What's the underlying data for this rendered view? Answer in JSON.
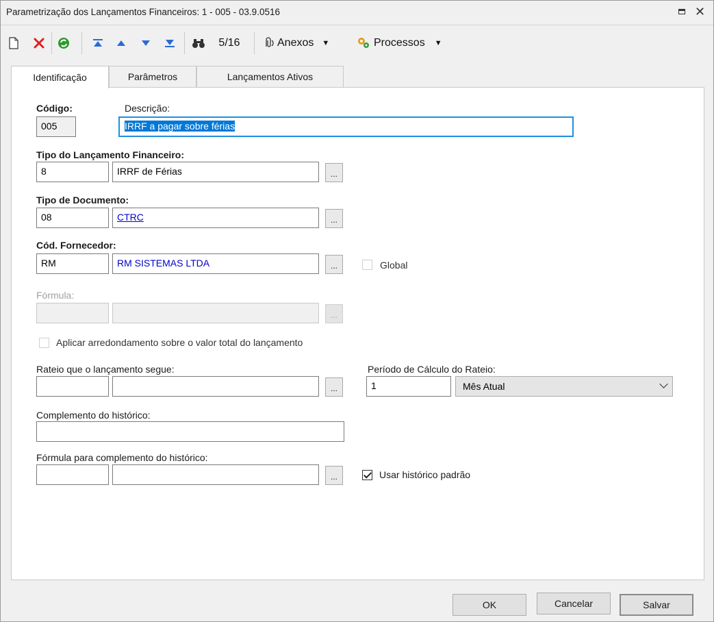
{
  "window": {
    "title": "Parametrização dos Lançamentos Financeiros: 1 - 005 - 03.9.0516"
  },
  "toolbar": {
    "record_position": "5/16",
    "attachments_label": "Anexos",
    "processes_label": "Processos"
  },
  "tabs": [
    {
      "label": "Identificação",
      "active": true
    },
    {
      "label": "Parâmetros",
      "active": false
    },
    {
      "label": "Lançamentos Ativos",
      "active": false
    }
  ],
  "form": {
    "codigo": {
      "label": "Código:",
      "value": "005"
    },
    "descricao": {
      "label": "Descrição:",
      "value": "IRRF  a pagar sobre férias"
    },
    "tipo_lancamento": {
      "label": "Tipo do Lançamento Financeiro:",
      "code": "8",
      "name": "IRRF de Férias"
    },
    "tipo_documento": {
      "label": "Tipo de Documento:",
      "code": "08",
      "name": "CTRC"
    },
    "fornecedor": {
      "label": "Cód. Fornecedor:",
      "code": "RM",
      "name": "RM SISTEMAS LTDA",
      "global_label": "Global",
      "global_checked": false
    },
    "formula": {
      "label": "Fórmula:",
      "code": "",
      "name": ""
    },
    "arredondamento": {
      "label": "Aplicar arredondamento sobre o valor total do lançamento",
      "checked": false
    },
    "rateio": {
      "label": "Rateio que o lançamento segue:",
      "code": "",
      "name": ""
    },
    "periodo_rateio": {
      "label": "Período de Cálculo do Rateio:",
      "value": "1",
      "selected": "Mês Atual"
    },
    "complemento": {
      "label": "Complemento do histórico:",
      "value": ""
    },
    "formula_complemento": {
      "label": "Fórmula para complemento do histórico:",
      "code": "",
      "name": ""
    },
    "usar_historico": {
      "label": "Usar histórico padrão",
      "checked": true
    },
    "ellipsis": "..."
  },
  "footer": {
    "ok_label": "OK",
    "cancel_label": "Cancelar",
    "save_label": "Salvar"
  },
  "colors": {
    "link_blue": "#0000cc",
    "selection_blue": "#0078d7",
    "focus_border": "#1e8fe1"
  }
}
